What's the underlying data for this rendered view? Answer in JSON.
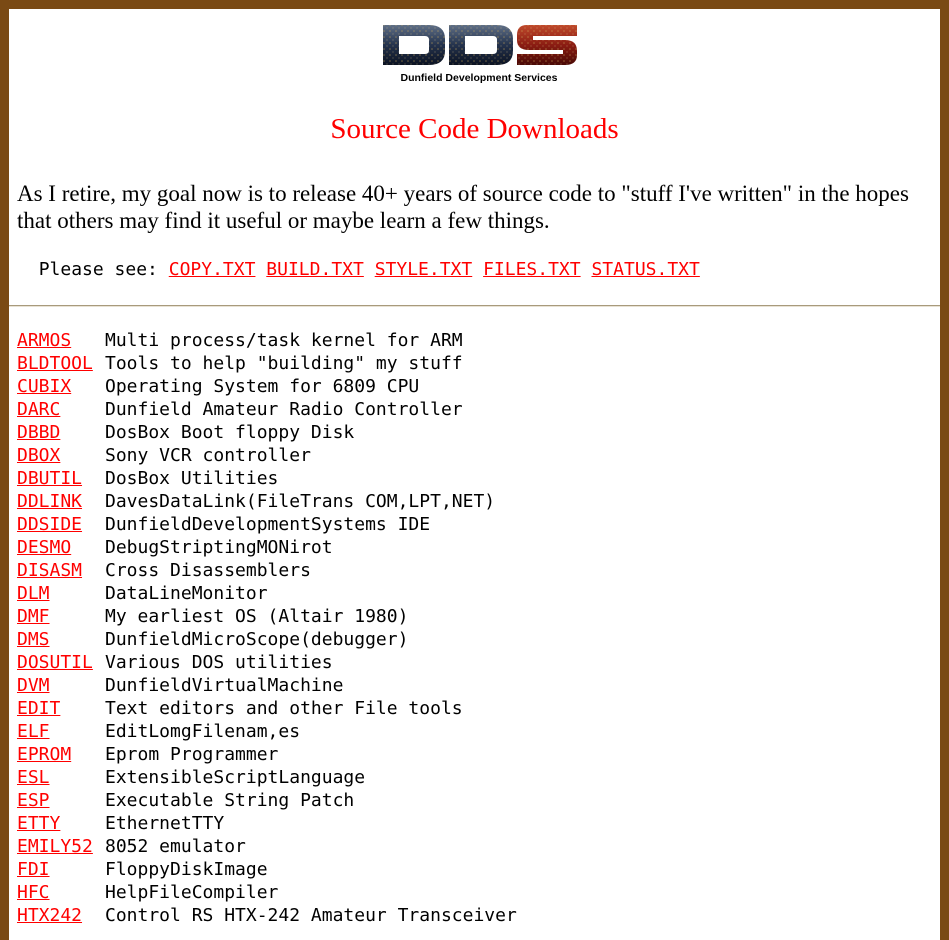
{
  "logo": {
    "letters": "DDS",
    "caption": "Dunfield Development Services"
  },
  "title": "Source Code Downloads",
  "intro": "As I retire, my goal now is to release 40+ years of source code to \"stuff I've written\" in the hopes that others may find it useful or maybe learn a few things.",
  "please_see": {
    "label": "Please see:",
    "links": [
      "COPY.TXT",
      "BUILD.TXT",
      "STYLE.TXT",
      "FILES.TXT",
      "STATUS.TXT"
    ]
  },
  "entries": [
    {
      "name": "ARMOS",
      "desc": "Multi process/task kernel for ARM"
    },
    {
      "name": "BLDTOOL",
      "desc": "Tools to help \"building\" my stuff"
    },
    {
      "name": "CUBIX",
      "desc": "Operating System for 6809 CPU"
    },
    {
      "name": "DARC",
      "desc": "Dunfield Amateur Radio Controller"
    },
    {
      "name": "DBBD",
      "desc": "DosBox Boot floppy Disk"
    },
    {
      "name": "DBOX",
      "desc": "Sony VCR controller"
    },
    {
      "name": "DBUTIL",
      "desc": "DosBox Utilities"
    },
    {
      "name": "DDLINK",
      "desc": "DavesDataLink(FileTrans COM,LPT,NET)"
    },
    {
      "name": "DDSIDE",
      "desc": "DunfieldDevelopmentSystems IDE"
    },
    {
      "name": "DESMO",
      "desc": "DebugStriptingMONirot"
    },
    {
      "name": "DISASM",
      "desc": "Cross Disassemblers"
    },
    {
      "name": "DLM",
      "desc": "DataLineMonitor"
    },
    {
      "name": "DMF",
      "desc": "My earliest OS (Altair 1980)"
    },
    {
      "name": "DMS",
      "desc": "DunfieldMicroScope(debugger)"
    },
    {
      "name": "DOSUTIL",
      "desc": "Various DOS utilities"
    },
    {
      "name": "DVM",
      "desc": "DunfieldVirtualMachine"
    },
    {
      "name": "EDIT",
      "desc": "Text editors and other File tools"
    },
    {
      "name": "ELF",
      "desc": "EditLomgFilenam,es"
    },
    {
      "name": "EPROM",
      "desc": "Eprom Programmer"
    },
    {
      "name": "ESL",
      "desc": "ExtensibleScriptLanguage"
    },
    {
      "name": "ESP",
      "desc": "Executable String Patch"
    },
    {
      "name": "ETTY",
      "desc": "EthernetTTY"
    },
    {
      "name": "EMILY52",
      "desc": "8052 emulator"
    },
    {
      "name": "FDI",
      "desc": "FloppyDiskImage"
    },
    {
      "name": "HFC",
      "desc": "HelpFileCompiler"
    },
    {
      "name": "HTX242",
      "desc": "Control RS HTX-242 Amateur Transceiver"
    }
  ]
}
